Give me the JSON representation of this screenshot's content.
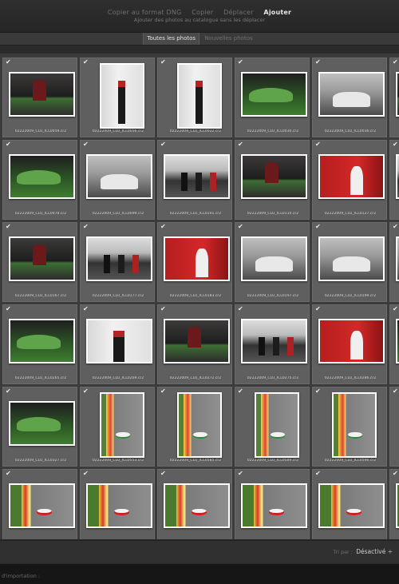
{
  "header": {
    "modes": [
      {
        "label": "Copier au format DNG",
        "active": false
      },
      {
        "label": "Copier",
        "active": false
      },
      {
        "label": "Déplacer",
        "active": false
      },
      {
        "label": "Ajouter",
        "active": true
      }
    ],
    "subtitle": "Ajouter des photos au catalogue sans les déplacer"
  },
  "filters": [
    {
      "label": "Toutes les photos",
      "active": true
    },
    {
      "label": "Nouvelles photos",
      "active": false
    }
  ],
  "check_glyph": "✔",
  "photos": [
    {
      "filename": "02222009_CLU_ICL0059.cr2",
      "orientation": "land",
      "palette": "ph-garage",
      "checked": true
    },
    {
      "filename": "02222009_CLU_ICL0056.cr2",
      "orientation": "port",
      "palette": "ph-white",
      "checked": true
    },
    {
      "filename": "02222009_CLU_ICL0022.cr2",
      "orientation": "port",
      "palette": "ph-white",
      "checked": true
    },
    {
      "filename": "02222009_CLU_ICL0030.cr2",
      "orientation": "land",
      "palette": "ph-green",
      "checked": true
    },
    {
      "filename": "02222009_CLU_ICL0036.cr2",
      "orientation": "land",
      "palette": "ph-pit",
      "checked": true
    },
    {
      "filename": "",
      "orientation": "land",
      "palette": "ph-garage",
      "checked": true
    },
    {
      "filename": "02222009_CLU_ICL0078.cr2",
      "orientation": "land",
      "palette": "ph-green",
      "checked": true
    },
    {
      "filename": "02222009_CLU_ICL0099.cr2",
      "orientation": "land",
      "palette": "ph-pit",
      "checked": true
    },
    {
      "filename": "02222009_CLU_ICL0101.cr2",
      "orientation": "land",
      "palette": "ph-crowd",
      "checked": true
    },
    {
      "filename": "02222009_CLU_ICL0110.cr2",
      "orientation": "land",
      "palette": "ph-garage",
      "checked": true
    },
    {
      "filename": "02222009_CLU_ICL0127.cr2",
      "orientation": "land",
      "palette": "ph-red",
      "checked": true
    },
    {
      "filename": "",
      "orientation": "land",
      "palette": "ph-crowd",
      "checked": true
    },
    {
      "filename": "02222009_CLU_ICL0167.cr2",
      "orientation": "land",
      "palette": "ph-garage",
      "checked": true
    },
    {
      "filename": "02222009_CLU_ICL0177.cr2",
      "orientation": "land",
      "palette": "ph-crowd",
      "checked": true
    },
    {
      "filename": "02222009_CLU_ICL0183.cr2",
      "orientation": "land",
      "palette": "ph-red",
      "checked": true
    },
    {
      "filename": "02222009_CLU_ICL0197.cr2",
      "orientation": "land",
      "palette": "ph-pit",
      "checked": true
    },
    {
      "filename": "02222009_CLU_ICL0199.cr2",
      "orientation": "land",
      "palette": "ph-pit",
      "checked": true
    },
    {
      "filename": "",
      "orientation": "land",
      "palette": "ph-pit",
      "checked": true
    },
    {
      "filename": "02222009_CLU_ICL0265.cr2",
      "orientation": "land",
      "palette": "ph-green",
      "checked": true
    },
    {
      "filename": "02222009_CLU_ICL0269.cr2",
      "orientation": "land",
      "palette": "ph-white",
      "checked": true
    },
    {
      "filename": "02222009_CLU_ICL0272.cr2",
      "orientation": "land",
      "palette": "ph-garage",
      "checked": true
    },
    {
      "filename": "02222009_CLU_ICL0275.cr2",
      "orientation": "land",
      "palette": "ph-crowd",
      "checked": true
    },
    {
      "filename": "02222009_CLU_ICL0286.cr2",
      "orientation": "land",
      "palette": "ph-red",
      "checked": true
    },
    {
      "filename": "",
      "orientation": "land",
      "palette": "ph-green",
      "checked": true
    },
    {
      "filename": "02222009_CLU_ICL0327.cr2",
      "orientation": "land",
      "palette": "ph-green",
      "checked": true
    },
    {
      "filename": "02222009_CLU_ICL0553.cr2",
      "orientation": "port",
      "palette": "ph-trackp",
      "checked": true
    },
    {
      "filename": "02222009_CLU_ICL0585.cr2",
      "orientation": "port",
      "palette": "ph-trackp",
      "checked": true
    },
    {
      "filename": "02222009_CLU_ICL0589.cr2",
      "orientation": "port",
      "palette": "ph-trackp",
      "checked": true
    },
    {
      "filename": "02222009_CLU_ICL0596.cr2",
      "orientation": "port",
      "palette": "ph-trackp",
      "checked": true
    },
    {
      "filename": "",
      "orientation": "port",
      "palette": "ph-trackp",
      "checked": true
    },
    {
      "filename": "",
      "orientation": "land",
      "palette": "ph-track",
      "checked": true
    },
    {
      "filename": "",
      "orientation": "land",
      "palette": "ph-track",
      "checked": true
    },
    {
      "filename": "",
      "orientation": "land",
      "palette": "ph-track",
      "checked": true
    },
    {
      "filename": "",
      "orientation": "land",
      "palette": "ph-track",
      "checked": true
    },
    {
      "filename": "",
      "orientation": "land",
      "palette": "ph-track",
      "checked": true
    },
    {
      "filename": "",
      "orientation": "land",
      "palette": "ph-track",
      "checked": true
    }
  ],
  "sort": {
    "label": "Tri par :",
    "value": "Désactivé ÷"
  },
  "status": {
    "text": "d'importation :"
  }
}
